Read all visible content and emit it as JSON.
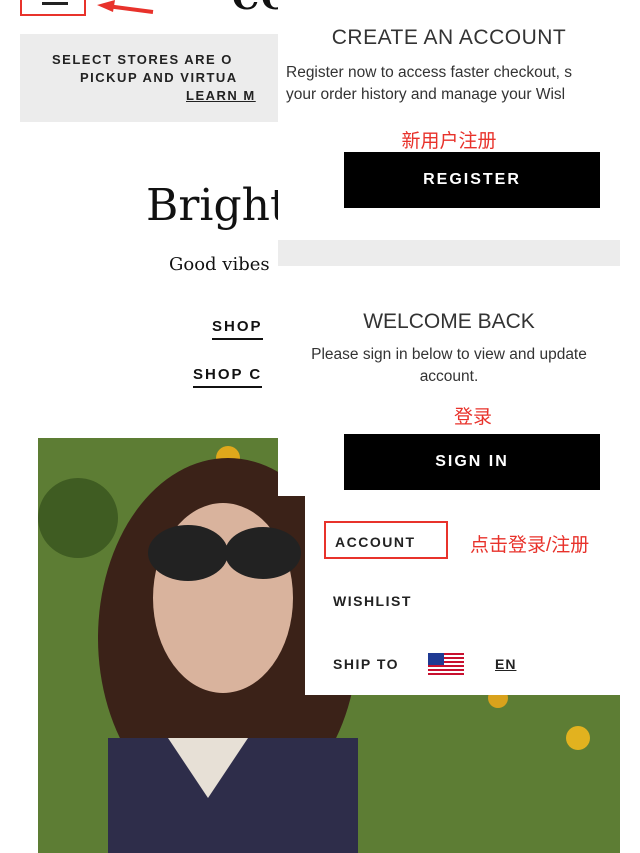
{
  "header": {
    "logo_text": "COACH",
    "menu_icon": "hamburger-icon",
    "search_icon": "search-icon",
    "bag_icon": "shopping-bag-icon"
  },
  "promo": {
    "line1": "SELECT STORES ARE O",
    "line2": "PICKUP AND VIRTUA",
    "line3": "LEARN M"
  },
  "hero": {
    "title": "Brighte",
    "subtitle": "Good vibes",
    "links": [
      "SHOP",
      "SHOP C"
    ]
  },
  "panel": {
    "create": {
      "title": "CREATE AN ACCOUNT",
      "desc_line1": "Register now to access faster checkout, s",
      "desc_line2": "your order history and manage your Wisl",
      "note": "新用户注册",
      "button": "REGISTER"
    },
    "welcome": {
      "title": "WELCOME BACK",
      "desc_line1": "Please sign in below to view and update",
      "desc_line2": "account.",
      "note": "登录",
      "button": "SIGN IN"
    },
    "menu": {
      "account": "ACCOUNT",
      "wishlist": "WISHLIST",
      "ship_to": "SHIP TO",
      "language": "EN",
      "note": "点击登录/注册"
    }
  },
  "colors": {
    "annotation_red": "#e8322b",
    "button_black": "#000000",
    "promo_gray": "#ececec"
  }
}
